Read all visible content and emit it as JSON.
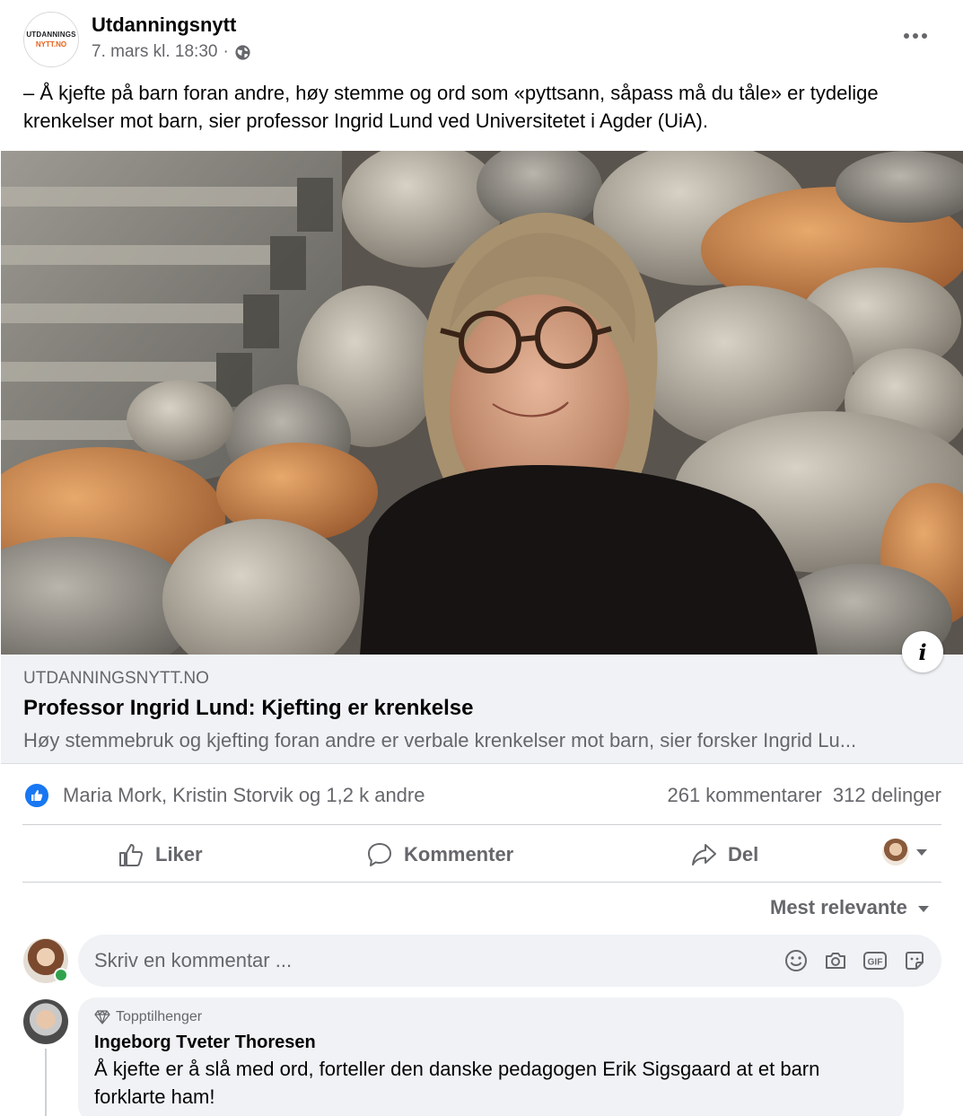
{
  "post": {
    "page_name": "Utdanningsnytt",
    "logo_line1": "UTDANNINGS",
    "logo_line2": "NYTT.NO",
    "timestamp": "7. mars kl. 18:30",
    "meta_separator": "·",
    "privacy_icon": "globe-icon",
    "more_icon": "more-options-icon",
    "text": "– Å kjefte på barn foran andre, høy stemme og ord som «pyttsann, såpass må du tåle» er tydelige krenkelser mot barn, sier professor Ingrid Lund ved Universitetet i Agder (UiA)."
  },
  "link_preview": {
    "domain": "UTDANNINGSNYTT.NO",
    "title": "Professor Ingrid Lund: Kjefting er krenkelse",
    "description": "Høy stemmebruk og kjefting foran andre er verbale krenkelser mot barn, sier forsker Ingrid Lu...",
    "info_icon": "i"
  },
  "stats": {
    "reaction_names": "Maria Mork, Kristin Storvik og 1,2 k andre",
    "comments": "261 kommentarer",
    "shares": "312 delinger"
  },
  "actions": {
    "like": "Liker",
    "comment": "Kommenter",
    "share": "Del"
  },
  "comments_section": {
    "sort_label": "Mest relevante",
    "composer_placeholder": "Skriv en kommentar ...",
    "gif_label": "GIF"
  },
  "top_comment": {
    "badge": "Topptilhenger",
    "author": "Ingeborg Tveter Thoresen",
    "text": "Å kjefte er å slå med ord, forteller den danske pedagogen Erik Sigsgaard at et barn forklarte ham!"
  },
  "colors": {
    "accent": "#1877f2",
    "secondary_text": "#65676b",
    "surface": "#f0f2f5",
    "online": "#31a24c"
  }
}
